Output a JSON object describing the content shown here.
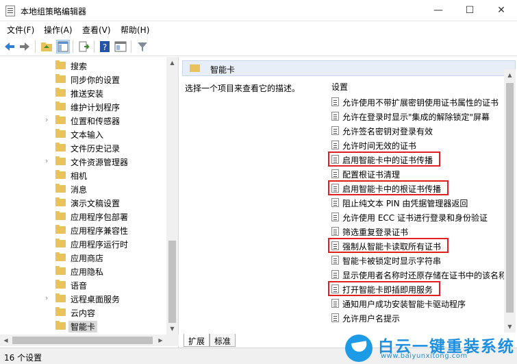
{
  "window": {
    "title": "本地组策略编辑器",
    "min_label": "—",
    "max_label": "☐",
    "close_label": "✕"
  },
  "menu": [
    "文件(F)",
    "操作(A)",
    "查看(V)",
    "帮助(H)"
  ],
  "toolbar": {
    "icons": [
      "back-arrow-icon",
      "forward-arrow-icon",
      "up-folder-icon",
      "show-hide-tree-icon",
      "export-icon",
      "help-icon",
      "properties-icon",
      "filter-icon"
    ]
  },
  "tree": {
    "items": [
      {
        "label": "搜索",
        "expandable": false
      },
      {
        "label": "同步你的设置",
        "expandable": false
      },
      {
        "label": "推送安装",
        "expandable": false
      },
      {
        "label": "维护计划程序",
        "expandable": false
      },
      {
        "label": "位置和传感器",
        "expandable": true
      },
      {
        "label": "文本输入",
        "expandable": false
      },
      {
        "label": "文件历史记录",
        "expandable": false
      },
      {
        "label": "文件资源管理器",
        "expandable": true
      },
      {
        "label": "相机",
        "expandable": false
      },
      {
        "label": "消息",
        "expandable": false
      },
      {
        "label": "演示文稿设置",
        "expandable": false
      },
      {
        "label": "应用程序包部署",
        "expandable": false
      },
      {
        "label": "应用程序兼容性",
        "expandable": false
      },
      {
        "label": "应用程序运行时",
        "expandable": false
      },
      {
        "label": "应用商店",
        "expandable": false
      },
      {
        "label": "应用隐私",
        "expandable": false
      },
      {
        "label": "语音",
        "expandable": false
      },
      {
        "label": "远程桌面服务",
        "expandable": true
      },
      {
        "label": "云内容",
        "expandable": false
      },
      {
        "label": "智能卡",
        "expandable": false,
        "selected": true
      }
    ]
  },
  "right": {
    "header_title": "智能卡",
    "description": "选择一个项目来查看它的描述。",
    "settings_header": "设置",
    "settings": [
      {
        "label": "允许使用不带扩展密钥使用证书属性的证书",
        "highlighted": false
      },
      {
        "label": "允许在登录时显示\"集成的解除锁定\"屏幕",
        "highlighted": false
      },
      {
        "label": "允许签名密钥对登录有效",
        "highlighted": false
      },
      {
        "label": "允许时间无效的证书",
        "highlighted": false
      },
      {
        "label": "启用智能卡中的证书传播",
        "highlighted": true
      },
      {
        "label": "配置根证书清理",
        "highlighted": false
      },
      {
        "label": "启用智能卡中的根证书传播",
        "highlighted": true
      },
      {
        "label": "阻止纯文本 PIN 由凭据管理器返回",
        "highlighted": false
      },
      {
        "label": "允许使用 ECC 证书进行登录和身份验证",
        "highlighted": false
      },
      {
        "label": "筛选重复登录证书",
        "highlighted": false
      },
      {
        "label": "强制从智能卡读取所有证书",
        "highlighted": true
      },
      {
        "label": "智能卡被锁定时显示字符串",
        "highlighted": false
      },
      {
        "label": "显示使用者名称时还原存储在证书中的该名称",
        "highlighted": false
      },
      {
        "label": "打开智能卡即插即用服务",
        "highlighted": true
      },
      {
        "label": "通知用户成功安装智能卡驱动程序",
        "highlighted": false
      },
      {
        "label": "允许用户名提示",
        "highlighted": false
      }
    ]
  },
  "tabs": [
    "扩展",
    "标准"
  ],
  "status": "16 个设置",
  "watermark": {
    "title": "白云一键重装系统",
    "url": "www.baiyunxitong.com"
  },
  "colors": {
    "highlight_border": "#e0201f",
    "accent": "#1e8fe0"
  }
}
